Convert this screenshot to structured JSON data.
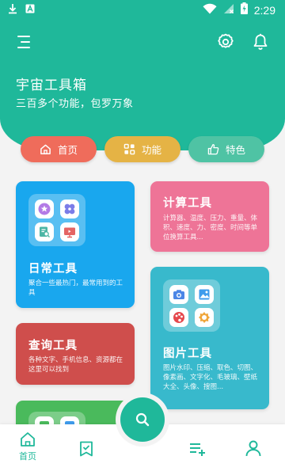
{
  "status_bar": {
    "time": "2:29",
    "icons": [
      "download-icon",
      "app-notification-icon",
      "wifi-icon",
      "no-signal-icon",
      "battery-charging-icon"
    ]
  },
  "header": {
    "title": "宇宙工具箱",
    "subtitle": "三百多个功能，包罗万象",
    "actions": [
      "menu-icon",
      "gear-icon",
      "bell-icon"
    ]
  },
  "tabs": [
    {
      "label": "首页",
      "icon": "home-icon",
      "color": "#ef6c5b"
    },
    {
      "label": "功能",
      "icon": "grid-icon",
      "color": "#e5b345"
    },
    {
      "label": "特色",
      "icon": "thumbs-up-icon",
      "color": "#4fc3a4"
    }
  ],
  "cards": {
    "daily": {
      "title": "日常工具",
      "desc": "聚合一些最热门，最常用到的工具",
      "color": "#19a7ee"
    },
    "calc": {
      "title": "计算工具",
      "desc": "计算器、温度、压力、重量、体积、速度、力、密度、时间等单位换算工具...",
      "color": "#ee7497"
    },
    "query": {
      "title": "查询工具",
      "desc": "各种文字、手机信息、资源都在这里可以找到",
      "color": "#cf4e4c"
    },
    "image": {
      "title": "图片工具",
      "desc": "图片水印、压缩、取色、切图、像素画、文字化、毛玻璃、壁纸大全、头像、搜图...",
      "color": "#38b9cc"
    },
    "green": {
      "color": "#4aba5c"
    }
  },
  "bottom_nav": {
    "home_label": "首页",
    "items": [
      "home-icon",
      "bookmark-check-icon",
      "search-icon",
      "playlist-add-icon",
      "user-icon"
    ],
    "accent": "#1fb89a"
  }
}
